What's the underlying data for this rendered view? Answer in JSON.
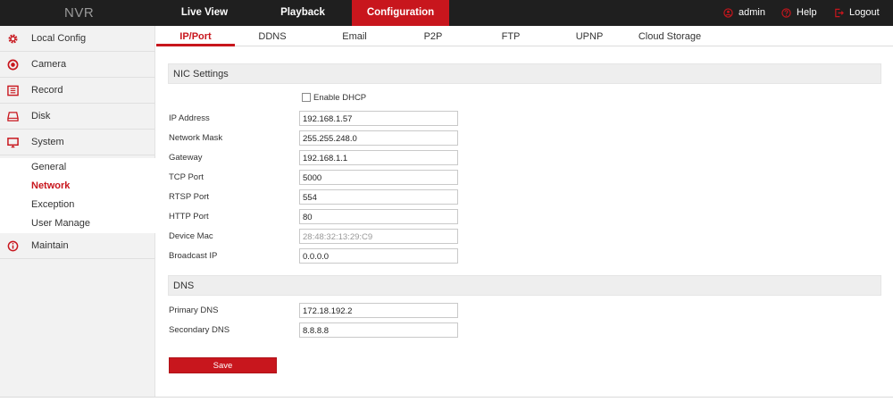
{
  "app": {
    "brand": "NVR"
  },
  "topnav": {
    "tabs": [
      {
        "label": "Live View"
      },
      {
        "label": "Playback"
      },
      {
        "label": "Configuration"
      }
    ],
    "user": "admin",
    "help": "Help",
    "logout": "Logout"
  },
  "sidebar": {
    "items": [
      {
        "label": "Local Config",
        "icon": "gear-icon"
      },
      {
        "label": "Camera",
        "icon": "camera-icon"
      },
      {
        "label": "Record",
        "icon": "record-icon"
      },
      {
        "label": "Disk",
        "icon": "disk-icon"
      },
      {
        "label": "System",
        "icon": "monitor-icon"
      },
      {
        "label": "Maintain",
        "icon": "info-icon"
      }
    ],
    "system_sub": [
      {
        "label": "General"
      },
      {
        "label": "Network"
      },
      {
        "label": "Exception"
      },
      {
        "label": "User Manage"
      }
    ]
  },
  "subtabs": [
    {
      "label": "IP/Port"
    },
    {
      "label": "DDNS"
    },
    {
      "label": "Email"
    },
    {
      "label": "P2P"
    },
    {
      "label": "FTP"
    },
    {
      "label": "UPNP"
    },
    {
      "label": "Cloud Storage"
    }
  ],
  "nic": {
    "title": "NIC Settings",
    "enable_dhcp": "Enable DHCP",
    "fields": [
      {
        "label": "IP Address",
        "value": "192.168.1.57"
      },
      {
        "label": "Network Mask",
        "value": "255.255.248.0"
      },
      {
        "label": "Gateway",
        "value": "192.168.1.1"
      },
      {
        "label": "TCP Port",
        "value": "5000"
      },
      {
        "label": "RTSP Port",
        "value": "554"
      },
      {
        "label": "HTTP Port",
        "value": "80"
      },
      {
        "label": "Device Mac",
        "value": "28:48:32:13:29:C9"
      },
      {
        "label": "Broadcast IP",
        "value": "0.0.0.0"
      }
    ]
  },
  "dns": {
    "title": "DNS",
    "fields": [
      {
        "label": "Primary DNS",
        "value": "172.18.192.2"
      },
      {
        "label": "Secondary DNS",
        "value": "8.8.8.8"
      }
    ]
  },
  "actions": {
    "save_label": "Save"
  },
  "colors": {
    "accent": "#c8161d",
    "topbar": "#1f1f1f",
    "sidebar": "#f2f2f2"
  }
}
